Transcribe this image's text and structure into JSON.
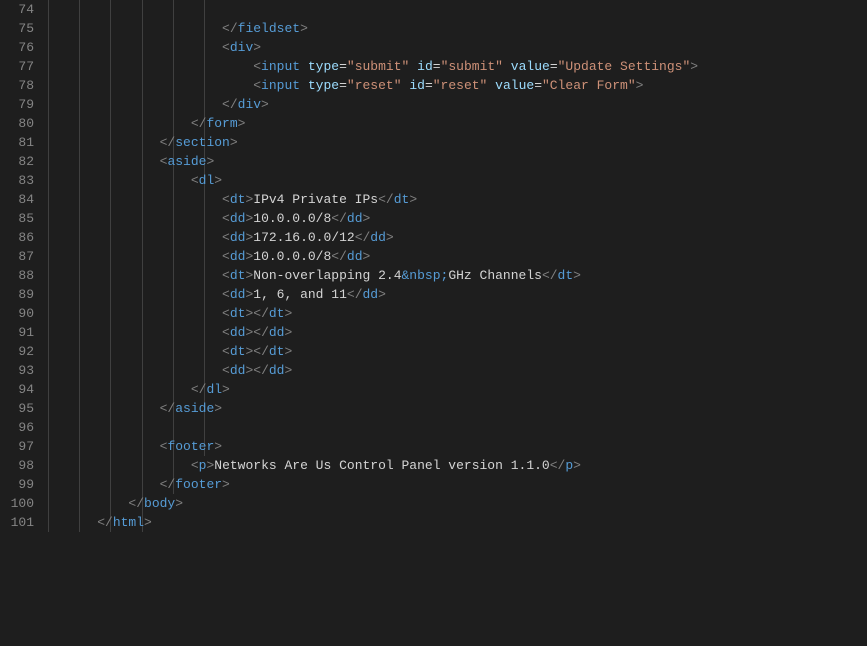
{
  "lines": [
    {
      "num": 74,
      "indent": 2,
      "tokens": []
    },
    {
      "num": 75,
      "indent": 5,
      "tokens": [
        [
          "bracket",
          "</"
        ],
        [
          "tag",
          "fieldset"
        ],
        [
          "bracket",
          ">"
        ]
      ]
    },
    {
      "num": 76,
      "indent": 5,
      "tokens": [
        [
          "bracket",
          "<"
        ],
        [
          "tag",
          "div"
        ],
        [
          "bracket",
          ">"
        ]
      ]
    },
    {
      "num": 77,
      "indent": 6,
      "tokens": [
        [
          "bracket",
          "<"
        ],
        [
          "tag",
          "input"
        ],
        [
          "text",
          " "
        ],
        [
          "attr",
          "type"
        ],
        [
          "text",
          "="
        ],
        [
          "str",
          "\"submit\""
        ],
        [
          "text",
          " "
        ],
        [
          "attr",
          "id"
        ],
        [
          "text",
          "="
        ],
        [
          "str",
          "\"submit\""
        ],
        [
          "text",
          " "
        ],
        [
          "attr",
          "value"
        ],
        [
          "text",
          "="
        ],
        [
          "str",
          "\"Update Settings\""
        ],
        [
          "bracket",
          ">"
        ]
      ]
    },
    {
      "num": 78,
      "indent": 6,
      "tokens": [
        [
          "bracket",
          "<"
        ],
        [
          "tag",
          "input"
        ],
        [
          "text",
          " "
        ],
        [
          "attr",
          "type"
        ],
        [
          "text",
          "="
        ],
        [
          "str",
          "\"reset\""
        ],
        [
          "text",
          " "
        ],
        [
          "attr",
          "id"
        ],
        [
          "text",
          "="
        ],
        [
          "str",
          "\"reset\""
        ],
        [
          "text",
          " "
        ],
        [
          "attr",
          "value"
        ],
        [
          "text",
          "="
        ],
        [
          "str",
          "\"Clear Form\""
        ],
        [
          "bracket",
          ">"
        ]
      ]
    },
    {
      "num": 79,
      "indent": 5,
      "tokens": [
        [
          "bracket",
          "</"
        ],
        [
          "tag",
          "div"
        ],
        [
          "bracket",
          ">"
        ]
      ]
    },
    {
      "num": 80,
      "indent": 4,
      "tokens": [
        [
          "bracket",
          "</"
        ],
        [
          "tag",
          "form"
        ],
        [
          "bracket",
          ">"
        ]
      ]
    },
    {
      "num": 81,
      "indent": 3,
      "tokens": [
        [
          "bracket",
          "</"
        ],
        [
          "tag",
          "section"
        ],
        [
          "bracket",
          ">"
        ]
      ]
    },
    {
      "num": 82,
      "indent": 3,
      "tokens": [
        [
          "bracket",
          "<"
        ],
        [
          "tag",
          "aside"
        ],
        [
          "bracket",
          ">"
        ]
      ]
    },
    {
      "num": 83,
      "indent": 4,
      "tokens": [
        [
          "bracket",
          "<"
        ],
        [
          "tag",
          "dl"
        ],
        [
          "bracket",
          ">"
        ]
      ]
    },
    {
      "num": 84,
      "indent": 5,
      "tokens": [
        [
          "bracket",
          "<"
        ],
        [
          "tag",
          "dt"
        ],
        [
          "bracket",
          ">"
        ],
        [
          "text",
          "IPv4 Private IPs"
        ],
        [
          "bracket",
          "</"
        ],
        [
          "tag",
          "dt"
        ],
        [
          "bracket",
          ">"
        ]
      ]
    },
    {
      "num": 85,
      "indent": 5,
      "tokens": [
        [
          "bracket",
          "<"
        ],
        [
          "tag",
          "dd"
        ],
        [
          "bracket",
          ">"
        ],
        [
          "text",
          "10.0.0.0/8"
        ],
        [
          "bracket",
          "</"
        ],
        [
          "tag",
          "dd"
        ],
        [
          "bracket",
          ">"
        ]
      ]
    },
    {
      "num": 86,
      "indent": 5,
      "tokens": [
        [
          "bracket",
          "<"
        ],
        [
          "tag",
          "dd"
        ],
        [
          "bracket",
          ">"
        ],
        [
          "text",
          "172.16.0.0/12"
        ],
        [
          "bracket",
          "</"
        ],
        [
          "tag",
          "dd"
        ],
        [
          "bracket",
          ">"
        ]
      ]
    },
    {
      "num": 87,
      "indent": 5,
      "tokens": [
        [
          "bracket",
          "<"
        ],
        [
          "tag",
          "dd"
        ],
        [
          "bracket",
          ">"
        ],
        [
          "text",
          "10.0.0.0/8"
        ],
        [
          "bracket",
          "</"
        ],
        [
          "tag",
          "dd"
        ],
        [
          "bracket",
          ">"
        ]
      ]
    },
    {
      "num": 88,
      "indent": 5,
      "tokens": [
        [
          "bracket",
          "<"
        ],
        [
          "tag",
          "dt"
        ],
        [
          "bracket",
          ">"
        ],
        [
          "text",
          "Non-overlapping 2.4"
        ],
        [
          "entity",
          "&nbsp;"
        ],
        [
          "text",
          "GHz Channels"
        ],
        [
          "bracket",
          "</"
        ],
        [
          "tag",
          "dt"
        ],
        [
          "bracket",
          ">"
        ]
      ]
    },
    {
      "num": 89,
      "indent": 5,
      "tokens": [
        [
          "bracket",
          "<"
        ],
        [
          "tag",
          "dd"
        ],
        [
          "bracket",
          ">"
        ],
        [
          "text",
          "1, 6, and 11"
        ],
        [
          "bracket",
          "</"
        ],
        [
          "tag",
          "dd"
        ],
        [
          "bracket",
          ">"
        ]
      ]
    },
    {
      "num": 90,
      "indent": 5,
      "tokens": [
        [
          "bracket",
          "<"
        ],
        [
          "tag",
          "dt"
        ],
        [
          "bracket",
          ">"
        ],
        [
          "bracket",
          "</"
        ],
        [
          "tag",
          "dt"
        ],
        [
          "bracket",
          ">"
        ]
      ]
    },
    {
      "num": 91,
      "indent": 5,
      "tokens": [
        [
          "bracket",
          "<"
        ],
        [
          "tag",
          "dd"
        ],
        [
          "bracket",
          ">"
        ],
        [
          "bracket",
          "</"
        ],
        [
          "tag",
          "dd"
        ],
        [
          "bracket",
          ">"
        ]
      ]
    },
    {
      "num": 92,
      "indent": 5,
      "tokens": [
        [
          "bracket",
          "<"
        ],
        [
          "tag",
          "dt"
        ],
        [
          "bracket",
          ">"
        ],
        [
          "bracket",
          "</"
        ],
        [
          "tag",
          "dt"
        ],
        [
          "bracket",
          ">"
        ]
      ]
    },
    {
      "num": 93,
      "indent": 5,
      "tokens": [
        [
          "bracket",
          "<"
        ],
        [
          "tag",
          "dd"
        ],
        [
          "bracket",
          ">"
        ],
        [
          "bracket",
          "</"
        ],
        [
          "tag",
          "dd"
        ],
        [
          "bracket",
          ">"
        ]
      ]
    },
    {
      "num": 94,
      "indent": 4,
      "tokens": [
        [
          "bracket",
          "</"
        ],
        [
          "tag",
          "dl"
        ],
        [
          "bracket",
          ">"
        ]
      ]
    },
    {
      "num": 95,
      "indent": 3,
      "tokens": [
        [
          "bracket",
          "</"
        ],
        [
          "tag",
          "aside"
        ],
        [
          "bracket",
          ">"
        ]
      ]
    },
    {
      "num": 96,
      "indent": 0,
      "tokens": []
    },
    {
      "num": 97,
      "indent": 3,
      "tokens": [
        [
          "bracket",
          "<"
        ],
        [
          "tag",
          "footer"
        ],
        [
          "bracket",
          ">"
        ]
      ]
    },
    {
      "num": 98,
      "indent": 4,
      "tokens": [
        [
          "bracket",
          "<"
        ],
        [
          "tag",
          "p"
        ],
        [
          "bracket",
          ">"
        ],
        [
          "text",
          "Networks Are Us Control Panel version 1.1.0"
        ],
        [
          "bracket",
          "</"
        ],
        [
          "tag",
          "p"
        ],
        [
          "bracket",
          ">"
        ]
      ]
    },
    {
      "num": 99,
      "indent": 3,
      "tokens": [
        [
          "bracket",
          "</"
        ],
        [
          "tag",
          "footer"
        ],
        [
          "bracket",
          ">"
        ]
      ]
    },
    {
      "num": 100,
      "indent": 2,
      "tokens": [
        [
          "bracket",
          "</"
        ],
        [
          "tag",
          "body"
        ],
        [
          "bracket",
          ">"
        ]
      ]
    },
    {
      "num": 101,
      "indent": 1,
      "tokens": [
        [
          "bracket",
          "</"
        ],
        [
          "tag",
          "html"
        ],
        [
          "bracket",
          ">"
        ]
      ]
    }
  ],
  "indentUnit": 4,
  "guideHeights": [
    28,
    28,
    28,
    28,
    26,
    24
  ]
}
